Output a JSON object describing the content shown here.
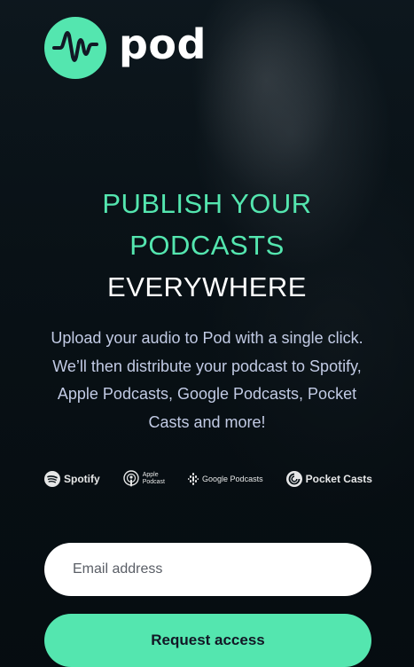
{
  "brand": {
    "name": "pod",
    "icon": "waveform-icon",
    "accent_color": "#54e6af"
  },
  "hero": {
    "title_line1": "PUBLISH YOUR",
    "title_line2": "PODCASTS",
    "title_line3": "EVERYWHERE",
    "description": "Upload your audio to Pod with a single click. We’ll then distribute your podcast to Spotify, Apple Podcasts, Google Podcasts, Pocket Casts and more!"
  },
  "platforms": {
    "spotify": "Spotify",
    "apple_line1": "Apple",
    "apple_line2": "Podcast",
    "google": "Google Podcasts",
    "pocket": "Pocket Casts"
  },
  "form": {
    "email_placeholder": "Email address",
    "email_value": "",
    "submit_label": "Request access"
  }
}
